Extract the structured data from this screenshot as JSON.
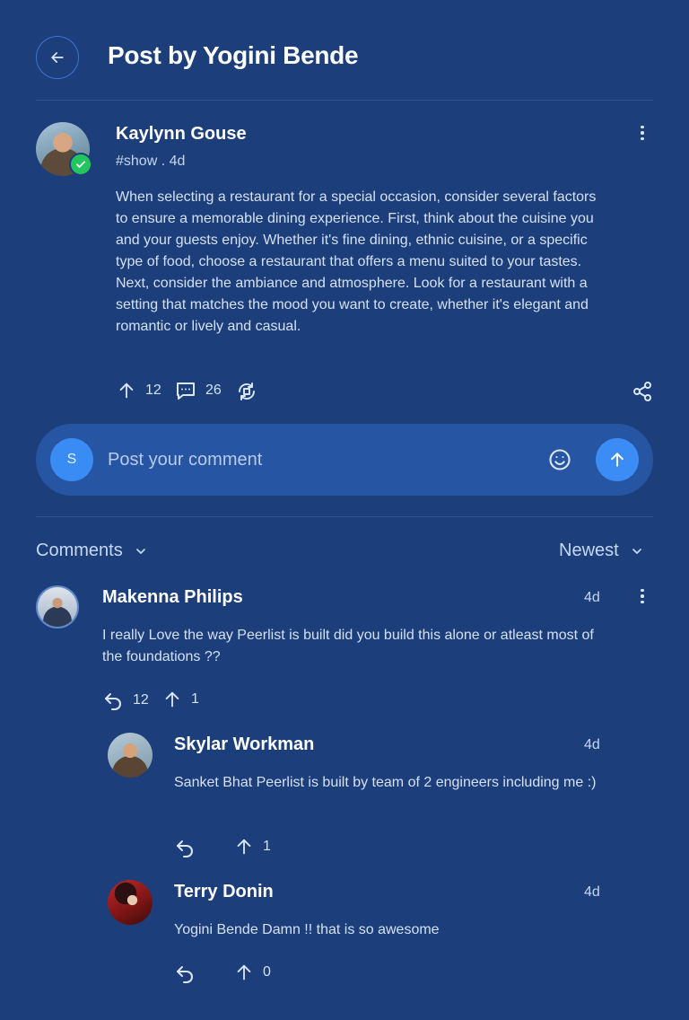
{
  "header": {
    "title": "Post by Yogini Bende"
  },
  "post": {
    "author": "Kaylynn Gouse",
    "meta": "#show . 4d",
    "body": "When selecting a restaurant for a special occasion, consider several factors to ensure a memorable dining experience. First, think about the cuisine you and your guests enjoy. Whether it's fine dining, ethnic cuisine, or a specific type of food, choose a restaurant that offers a menu suited to your tastes. Next, consider the ambiance and atmosphere. Look for a restaurant with a setting that matches the mood you want to create, whether it's elegant and romantic or lively and casual.",
    "upvotes": "12",
    "comments": "26"
  },
  "composer": {
    "avatar_initial": "S",
    "placeholder": "Post your comment"
  },
  "comments_header": {
    "label": "Comments",
    "sort": "Newest"
  },
  "comments": [
    {
      "author": "Makenna Philips",
      "time": "4d",
      "text": "I really Love the way Peerlist is built did you build this alone or atleast most of the foundations ??",
      "replies": "12",
      "upvotes": "1"
    },
    {
      "author": "Skylar Workman",
      "time": "4d",
      "text": "Sanket Bhat Peerlist is built by team of 2 engineers including me :)",
      "upvotes": "1"
    },
    {
      "author": "Terry Donin",
      "time": "4d",
      "text": "Yogini Bende Damn !! that is so awesome",
      "upvotes": "0"
    }
  ],
  "colors": {
    "background": "#1c3f7c",
    "accent": "#3b8df5",
    "verified": "#22c55e",
    "composer_bg": "#2656a3"
  }
}
